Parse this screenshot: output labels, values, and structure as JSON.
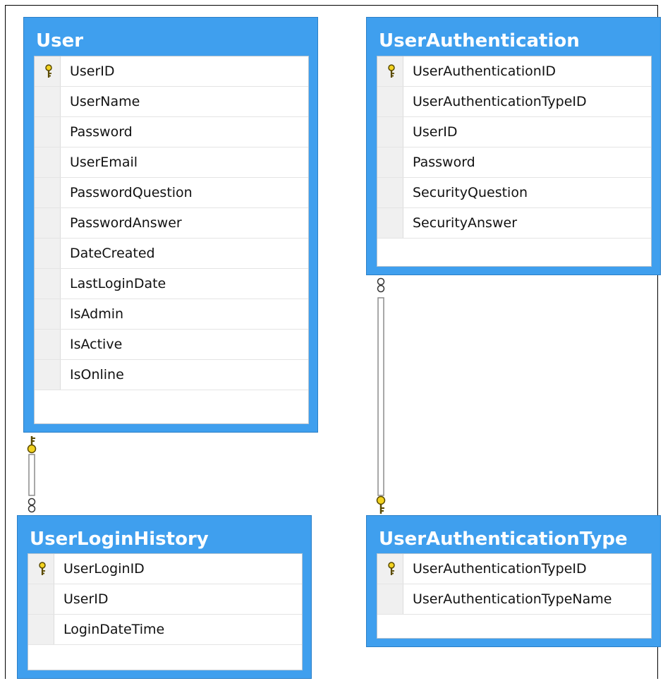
{
  "tables": [
    {
      "id": "user",
      "title": "User",
      "columns": [
        {
          "name": "UserID",
          "pk": true
        },
        {
          "name": "UserName",
          "pk": false
        },
        {
          "name": "Password",
          "pk": false
        },
        {
          "name": "UserEmail",
          "pk": false
        },
        {
          "name": "PasswordQuestion",
          "pk": false
        },
        {
          "name": "PasswordAnswer",
          "pk": false
        },
        {
          "name": "DateCreated",
          "pk": false
        },
        {
          "name": "LastLoginDate",
          "pk": false
        },
        {
          "name": "IsAdmin",
          "pk": false
        },
        {
          "name": "IsActive",
          "pk": false
        },
        {
          "name": "IsOnline",
          "pk": false
        }
      ]
    },
    {
      "id": "user-authentication",
      "title": "UserAuthentication",
      "columns": [
        {
          "name": "UserAuthenticationID",
          "pk": true
        },
        {
          "name": "UserAuthenticationTypeID",
          "pk": false
        },
        {
          "name": "UserID",
          "pk": false
        },
        {
          "name": "Password",
          "pk": false
        },
        {
          "name": "SecurityQuestion",
          "pk": false
        },
        {
          "name": "SecurityAnswer",
          "pk": false
        }
      ]
    },
    {
      "id": "user-login-history",
      "title": "UserLoginHistory",
      "columns": [
        {
          "name": "UserLoginID",
          "pk": true
        },
        {
          "name": "UserID",
          "pk": false
        },
        {
          "name": "LoginDateTime",
          "pk": false
        }
      ]
    },
    {
      "id": "user-authentication-type",
      "title": "UserAuthenticationType",
      "columns": [
        {
          "name": "UserAuthenticationTypeID",
          "pk": true
        },
        {
          "name": "UserAuthenticationTypeName",
          "pk": false
        }
      ]
    }
  ],
  "relationships": [
    {
      "from": "user",
      "to": "user-login-history",
      "from_end": "key",
      "to_end": "infinity"
    },
    {
      "from": "user-authentication-type",
      "to": "user-authentication",
      "from_end": "key",
      "to_end": "infinity"
    }
  ],
  "colors": {
    "header": "#3f9fee",
    "key": "#f2d21f"
  }
}
